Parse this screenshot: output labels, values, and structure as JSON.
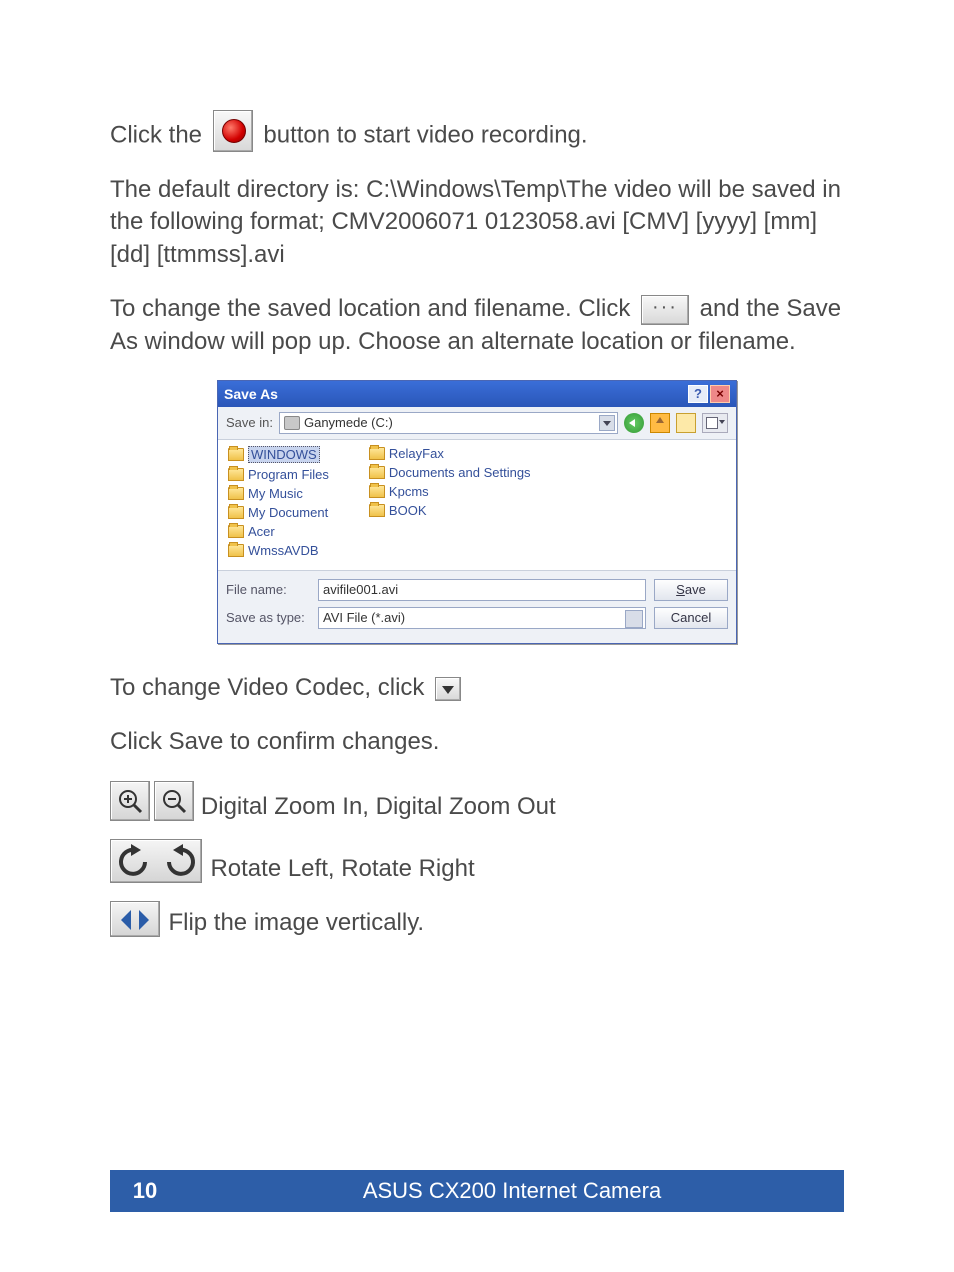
{
  "paragraphs": {
    "p1_a": "Click the",
    "p1_b": "button to start video recording.",
    "p2": "The default directory is:  C:\\Windows\\Temp\\The video will be saved in the following format;  CMV2006071  0123058.avi   [CMV] [yyyy] [mm] [dd] [ttmmss].avi",
    "p3_a": "To change the saved location and filename. Click",
    "p3_b": "and the Save As window will pop up. Choose an alternate location or filename.",
    "p4": "To change Video Codec, click",
    "p5": "Click Save to confirm changes.",
    "zoom": "Digital Zoom In, Digital Zoom Out",
    "rotate": "Rotate Left, Rotate Right",
    "flip": "Flip the image vertically."
  },
  "dialog": {
    "title": "Save As",
    "help": "?",
    "close": "×",
    "savein_label": "Save in:",
    "savein_value": "Ganymede (C:)",
    "folders_col1": [
      "WINDOWS",
      "Program Files",
      "My Music",
      "My Document",
      "Acer",
      "WmssAVDB"
    ],
    "folders_col2": [
      "RelayFax",
      "Documents and Settings",
      "Kpcms",
      "BOOK"
    ],
    "filename_label": "File name:",
    "filename_value": "avifile001.avi",
    "saveastype_label": "Save as type:",
    "saveastype_value": "AVI File (*.avi)",
    "save_btn": "Save",
    "cancel_btn": "Cancel"
  },
  "footer": {
    "page": "10",
    "title": "ASUS CX200 Internet Camera"
  }
}
